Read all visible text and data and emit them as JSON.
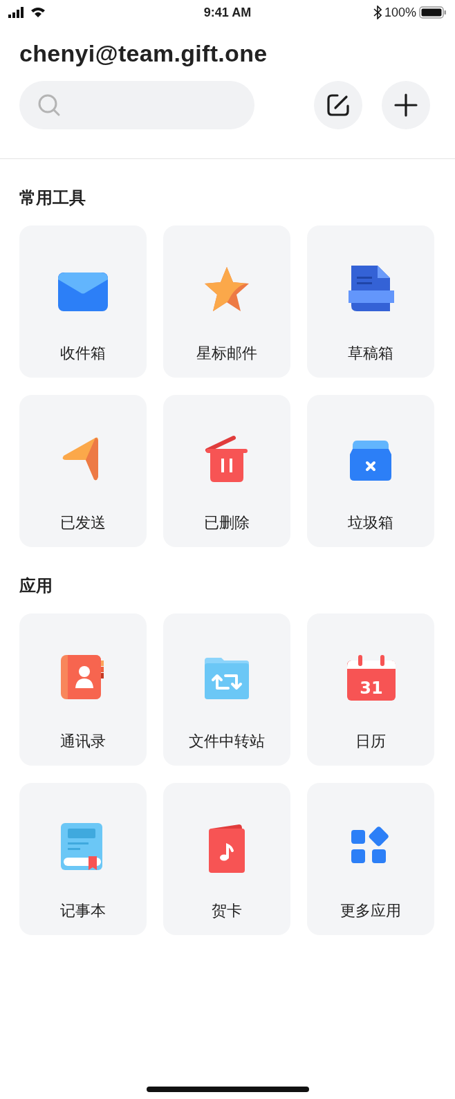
{
  "status_bar": {
    "time": "9:41 AM",
    "battery": "100%"
  },
  "account": {
    "email": "chenyi@team.gift.one"
  },
  "sections": [
    {
      "title": "常用工具",
      "items": [
        {
          "label": "收件箱",
          "kind": "envelope"
        },
        {
          "label": "星标邮件",
          "kind": "star"
        },
        {
          "label": "草稿箱",
          "kind": "document"
        },
        {
          "label": "已发送",
          "kind": "send"
        },
        {
          "label": "已删除",
          "kind": "trash"
        },
        {
          "label": "垃圾箱",
          "kind": "box"
        }
      ]
    },
    {
      "title": "应用",
      "items": [
        {
          "label": "通讯录",
          "kind": "contacts"
        },
        {
          "label": "文件中转站",
          "kind": "folder"
        },
        {
          "label": "日历",
          "kind": "calendar",
          "badge": "31"
        },
        {
          "label": "记事本",
          "kind": "notebook"
        },
        {
          "label": "贺卡",
          "kind": "card"
        },
        {
          "label": "更多应用",
          "kind": "apps"
        }
      ]
    }
  ]
}
